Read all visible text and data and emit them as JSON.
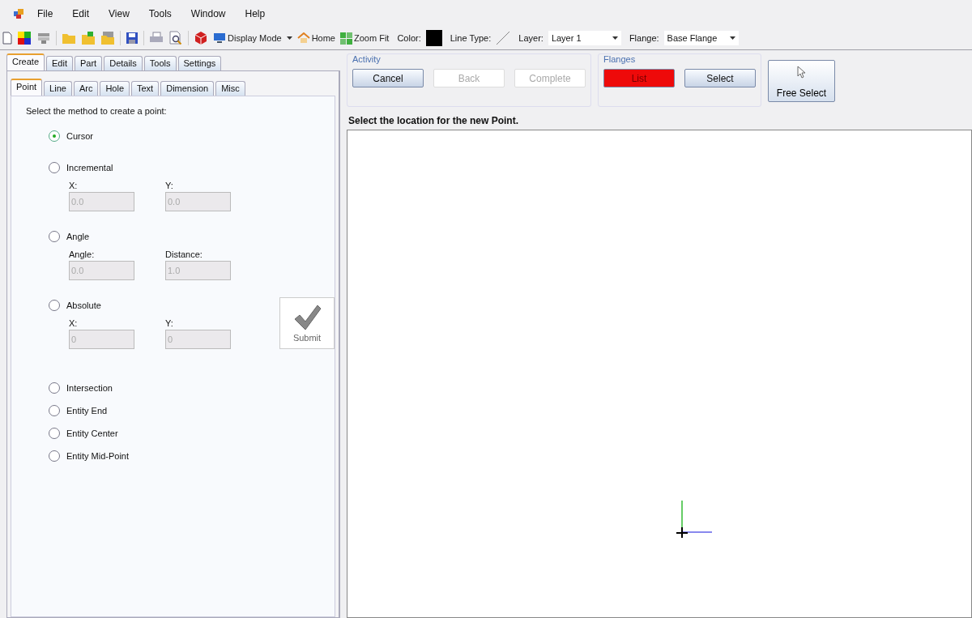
{
  "menu": [
    "File",
    "Edit",
    "View",
    "Tools",
    "Window",
    "Help"
  ],
  "toolbar": {
    "display_mode": "Display Mode",
    "home": "Home",
    "zoom_fit": "Zoom Fit",
    "color_label": "Color:",
    "color": "#000000",
    "line_type_label": "Line Type:",
    "layer_label": "Layer:",
    "layer_value": "Layer 1",
    "flange_label": "Flange:",
    "flange_value": "Base Flange"
  },
  "main_tabs": [
    {
      "label": "Create",
      "selected": true
    },
    {
      "label": "Edit",
      "selected": false
    },
    {
      "label": "Part",
      "selected": false
    },
    {
      "label": "Details",
      "selected": false
    },
    {
      "label": "Tools",
      "selected": false
    },
    {
      "label": "Settings",
      "selected": false
    }
  ],
  "sub_tabs": [
    {
      "label": "Point",
      "selected": true
    },
    {
      "label": "Line",
      "selected": false
    },
    {
      "label": "Arc",
      "selected": false
    },
    {
      "label": "Hole",
      "selected": false
    },
    {
      "label": "Text",
      "selected": false
    },
    {
      "label": "Dimension",
      "selected": false
    },
    {
      "label": "Misc",
      "selected": false
    }
  ],
  "instruction": "Select the method to create a point:",
  "methods": [
    {
      "label": "Cursor",
      "selected": true
    },
    {
      "label": "Incremental",
      "selected": false,
      "fields": [
        {
          "label": "X:",
          "value": "0.0",
          "disabled": true
        },
        {
          "label": "Y:",
          "value": "0.0",
          "disabled": true
        }
      ]
    },
    {
      "label": "Angle",
      "selected": false,
      "fields": [
        {
          "label": "Angle:",
          "value": "0.0",
          "disabled": true
        },
        {
          "label": "Distance:",
          "value": "1.0",
          "disabled": true
        }
      ]
    },
    {
      "label": "Absolute",
      "selected": false,
      "fields": [
        {
          "label": "X:",
          "value": "0",
          "disabled": true
        },
        {
          "label": "Y:",
          "value": "0",
          "disabled": true
        }
      ],
      "submit": "Submit"
    },
    {
      "label": "Intersection",
      "selected": false
    },
    {
      "label": "Entity End",
      "selected": false
    },
    {
      "label": "Entity Center",
      "selected": false
    },
    {
      "label": "Entity Mid-Point",
      "selected": false
    }
  ],
  "activity": {
    "title": "Activity",
    "buttons": [
      {
        "label": "Cancel",
        "disabled": false
      },
      {
        "label": "Back",
        "disabled": true
      },
      {
        "label": "Complete",
        "disabled": true
      }
    ]
  },
  "flanges": {
    "title": "Flanges",
    "buttons": [
      {
        "label": "List",
        "highlighted": true
      },
      {
        "label": "Select",
        "highlighted": false
      }
    ]
  },
  "free_select": "Free Select",
  "prompt": "Select the location for the new Point."
}
